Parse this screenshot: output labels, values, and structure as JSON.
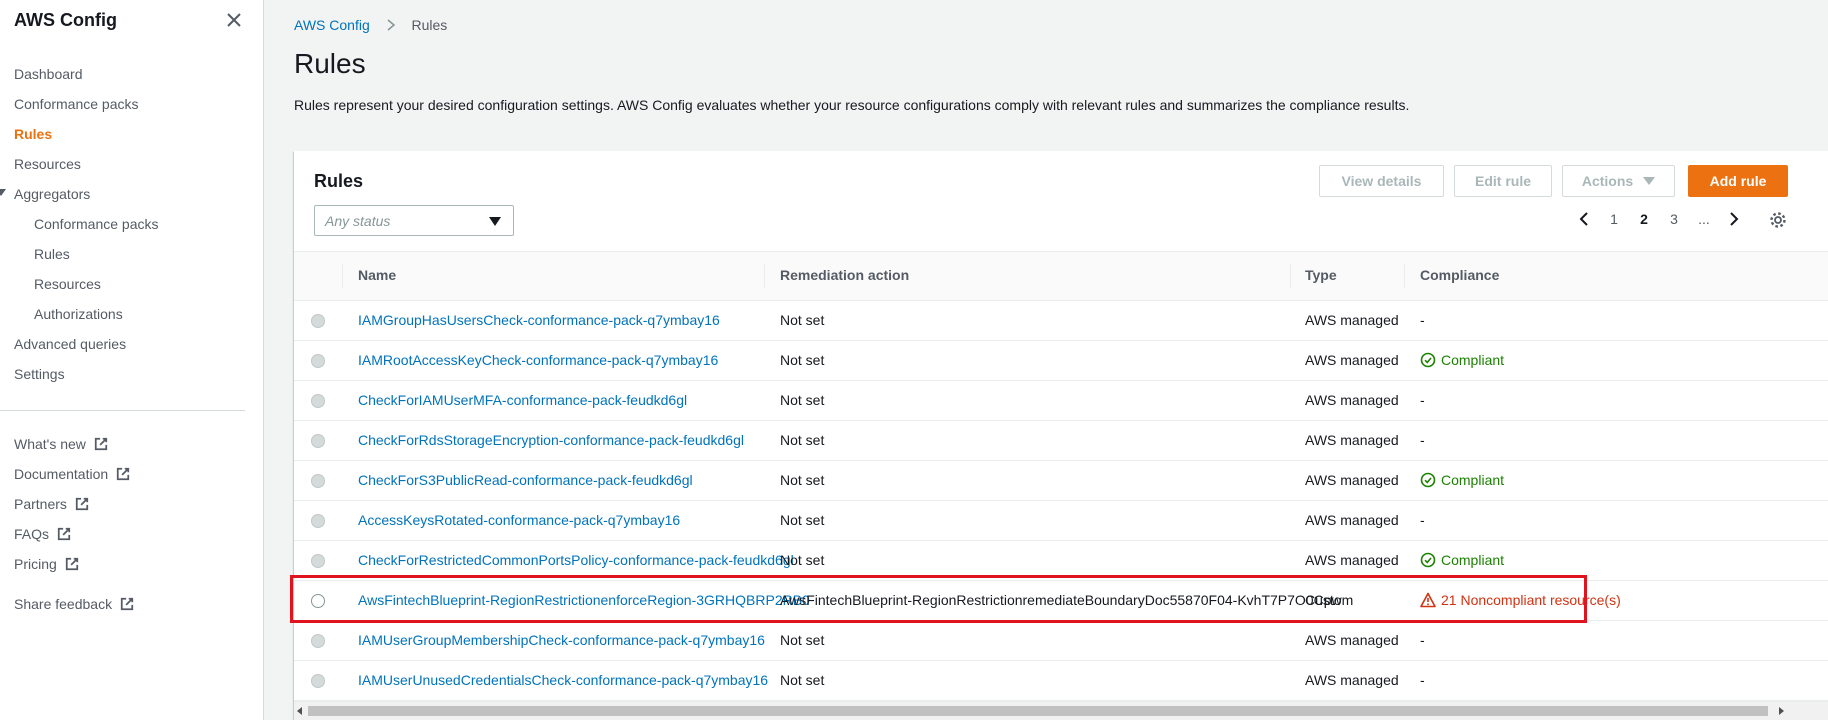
{
  "sidebar": {
    "title": "AWS Config",
    "nav": [
      {
        "label": "Dashboard"
      },
      {
        "label": "Conformance packs"
      },
      {
        "label": "Rules"
      },
      {
        "label": "Resources"
      },
      {
        "label": "Aggregators"
      },
      {
        "label": "Conformance packs"
      },
      {
        "label": "Rules"
      },
      {
        "label": "Resources"
      },
      {
        "label": "Authorizations"
      },
      {
        "label": "Advanced queries"
      },
      {
        "label": "Settings"
      }
    ],
    "external": [
      {
        "label": "What's new"
      },
      {
        "label": "Documentation"
      },
      {
        "label": "Partners"
      },
      {
        "label": "FAQs"
      },
      {
        "label": "Pricing"
      },
      {
        "label": "Share feedback"
      }
    ]
  },
  "breadcrumb": {
    "root": "AWS Config",
    "current": "Rules"
  },
  "page": {
    "title": "Rules",
    "description": "Rules represent your desired configuration settings. AWS Config evaluates whether your resource configurations comply with relevant rules and summarizes the compliance results."
  },
  "panel": {
    "title": "Rules",
    "buttons": {
      "view_details": "View details",
      "edit_rule": "Edit rule",
      "actions": "Actions",
      "add_rule": "Add rule"
    },
    "status_placeholder": "Any status",
    "pagination": {
      "pages": [
        "1",
        "2",
        "3",
        "..."
      ],
      "current": "2"
    }
  },
  "table": {
    "columns": [
      "Name",
      "Remediation action",
      "Type",
      "Compliance"
    ],
    "rows": [
      {
        "name": "IAMGroupHasUsersCheck-conformance-pack-q7ymbay16",
        "remediation": "Not set",
        "type": "AWS managed",
        "compliance": "-",
        "status": "none"
      },
      {
        "name": "IAMRootAccessKeyCheck-conformance-pack-q7ymbay16",
        "remediation": "Not set",
        "type": "AWS managed",
        "compliance": "Compliant",
        "status": "ok"
      },
      {
        "name": "CheckForIAMUserMFA-conformance-pack-feudkd6gl",
        "remediation": "Not set",
        "type": "AWS managed",
        "compliance": "-",
        "status": "none"
      },
      {
        "name": "CheckForRdsStorageEncryption-conformance-pack-feudkd6gl",
        "remediation": "Not set",
        "type": "AWS managed",
        "compliance": "-",
        "status": "none"
      },
      {
        "name": "CheckForS3PublicRead-conformance-pack-feudkd6gl",
        "remediation": "Not set",
        "type": "AWS managed",
        "compliance": "Compliant",
        "status": "ok"
      },
      {
        "name": "AccessKeysRotated-conformance-pack-q7ymbay16",
        "remediation": "Not set",
        "type": "AWS managed",
        "compliance": "-",
        "status": "none"
      },
      {
        "name": "CheckForRestrictedCommonPortsPolicy-conformance-pack-feudkd6gl",
        "remediation": "Not set",
        "type": "AWS managed",
        "compliance": "Compliant",
        "status": "ok"
      },
      {
        "name": "AwsFintechBlueprint-RegionRestrictionenforceRegion-3GRHQBRP2RB0",
        "remediation": "AwsFintechBlueprint-RegionRestrictionremediateBoundaryDoc55870F04-KvhT7P7O0Cpw",
        "type": "Custom",
        "compliance": "21 Noncompliant resource(s)",
        "status": "bad"
      },
      {
        "name": "IAMUserGroupMembershipCheck-conformance-pack-q7ymbay16",
        "remediation": "Not set",
        "type": "AWS managed",
        "compliance": "-",
        "status": "none"
      },
      {
        "name": "IAMUserUnusedCredentialsCheck-conformance-pack-q7ymbay16",
        "remediation": "Not set",
        "type": "AWS managed",
        "compliance": "-",
        "status": "none"
      }
    ]
  },
  "colors": {
    "accent": "#ec7211",
    "link": "#0073bb",
    "ok": "#1d8102",
    "bad": "#d13212",
    "highlight": "#e0141e"
  }
}
